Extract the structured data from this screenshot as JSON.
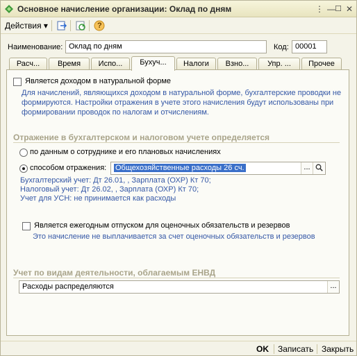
{
  "window": {
    "title": "Основное начисление организации: Оклад по дням",
    "controls": {
      "menu": "⋮",
      "minimize": "—",
      "maximize": "☐",
      "close": "✕"
    }
  },
  "toolbar": {
    "actions_label": "Действия",
    "actions_arrow": "▾",
    "help": "?"
  },
  "header": {
    "name_label": "Наименование:",
    "name_value": "Оклад по дням",
    "code_label": "Код:",
    "code_value": "00001"
  },
  "tabs": [
    {
      "label": "Расч..."
    },
    {
      "label": "Время"
    },
    {
      "label": "Испо..."
    },
    {
      "label": "Бухуч..."
    },
    {
      "label": "Налоги"
    },
    {
      "label": "Взно..."
    },
    {
      "label": "Упр. ..."
    },
    {
      "label": "Прочее"
    }
  ],
  "panel": {
    "natural_checkbox_label": "Является доходом в натуральной форме",
    "natural_note_1": "Для начислений, являющихся доходом в натуральной форме, бухгалтерские проводки не",
    "natural_note_2": "формируются. Настройки отражения в учете этого начисления будут использованы при",
    "natural_note_3": "формировании проводок по налогам и отчислениям.",
    "reflect_section": "Отражение в бухгалтерском и налоговом учете определяется",
    "radio_employee_label": "по данным о сотруднике и его плановых начислениях",
    "radio_method_label": "способом отражения:",
    "method_value": "Общехозяйственные расходы 26 сч.",
    "select_btn": "...",
    "accounting_line": "Бухгалтерский учет: Дт 26.01, , Зарплата (ОХР) Кт 70;",
    "tax_line": "Налоговый учет: Дт 26.02, , Зарплата (ОХР) Кт 70;",
    "usn_line": "Учет для УСН: не принимается как расходы",
    "vacation_checkbox_label": "Является ежегодным отпуском для оценочных обязательств и резервов",
    "vacation_note": "Это начисление не выплачивается за счет оценочных обязательств и резервов",
    "envd_section": "Учет по видам деятельности, облагаемым ЕНВД",
    "envd_value": "Расходы распределяются",
    "envd_btn": "..."
  },
  "footer": {
    "ok": "OK",
    "save": "Записать",
    "close": "Закрыть"
  },
  "colors": {
    "accent": "#3a6fc9",
    "note_text": "#3457a6",
    "section_text": "#a9a48a"
  }
}
